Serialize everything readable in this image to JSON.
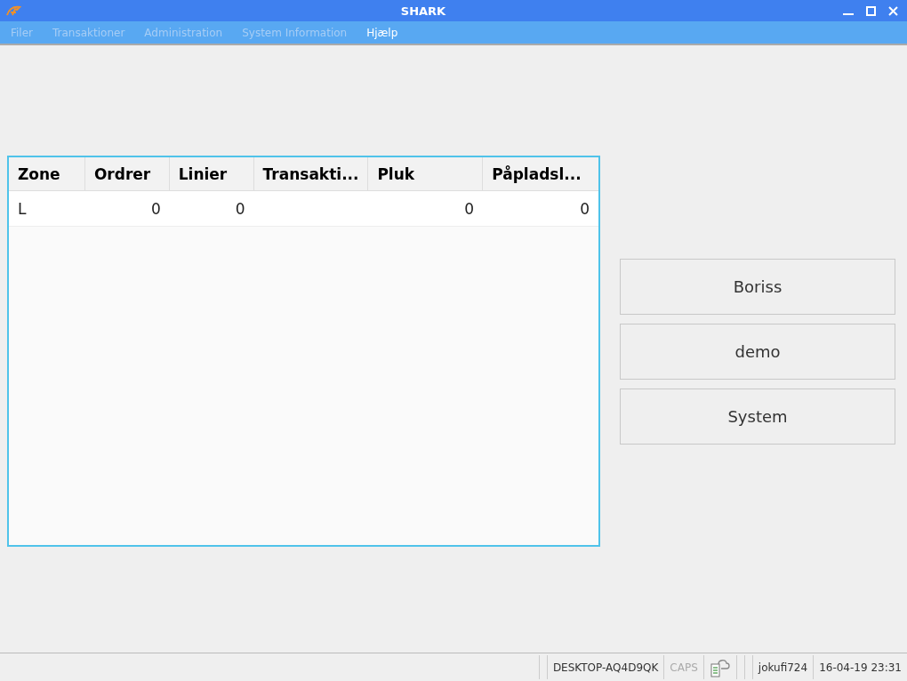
{
  "window": {
    "title": "SHARK"
  },
  "menu": [
    {
      "label": "Filer",
      "disabled": true
    },
    {
      "label": "Transaktioner",
      "disabled": true
    },
    {
      "label": "Administration",
      "disabled": true
    },
    {
      "label": "System Information",
      "disabled": true
    },
    {
      "label": "Hjælp",
      "disabled": false
    }
  ],
  "table": {
    "columns": [
      {
        "label": "Zone",
        "kind": "text"
      },
      {
        "label": "Ordrer",
        "kind": "number"
      },
      {
        "label": "Linier",
        "kind": "number"
      },
      {
        "label": "Transakti...",
        "kind": "number"
      },
      {
        "label": "Pluk",
        "kind": "number"
      },
      {
        "label": "Påpladsl...",
        "kind": "number"
      }
    ],
    "rows": [
      [
        "L",
        "0",
        "0",
        null,
        "0",
        "0"
      ]
    ]
  },
  "user_buttons": [
    "Boriss",
    "demo",
    "System"
  ],
  "status_bar": [
    {
      "kind": "empty"
    },
    {
      "kind": "text",
      "text": "DESKTOP-AQ4D9QK",
      "disabled": false
    },
    {
      "kind": "text",
      "text": "CAPS",
      "disabled": true
    },
    {
      "kind": "icon"
    },
    {
      "kind": "empty"
    },
    {
      "kind": "empty"
    },
    {
      "kind": "text",
      "text": "jokufi724",
      "disabled": false
    },
    {
      "kind": "text",
      "text": "16-04-19 23:31",
      "disabled": false
    }
  ]
}
